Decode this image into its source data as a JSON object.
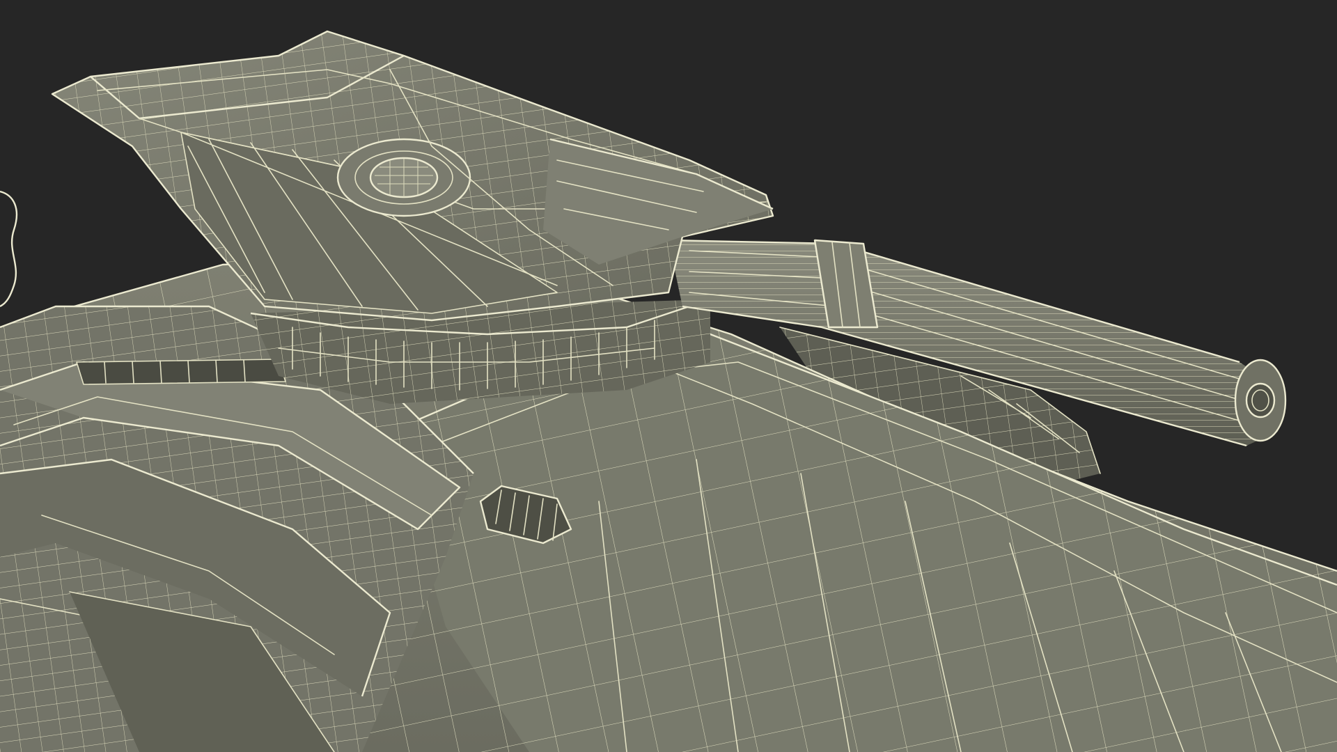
{
  "scene": {
    "subject": "tank-turret-wireframe",
    "colors": {
      "background": "#262626",
      "surface_light": "#7b7c6e",
      "surface_mid": "#6e6f62",
      "surface_dark": "#55564b",
      "wire": "#e4e2c4"
    }
  }
}
